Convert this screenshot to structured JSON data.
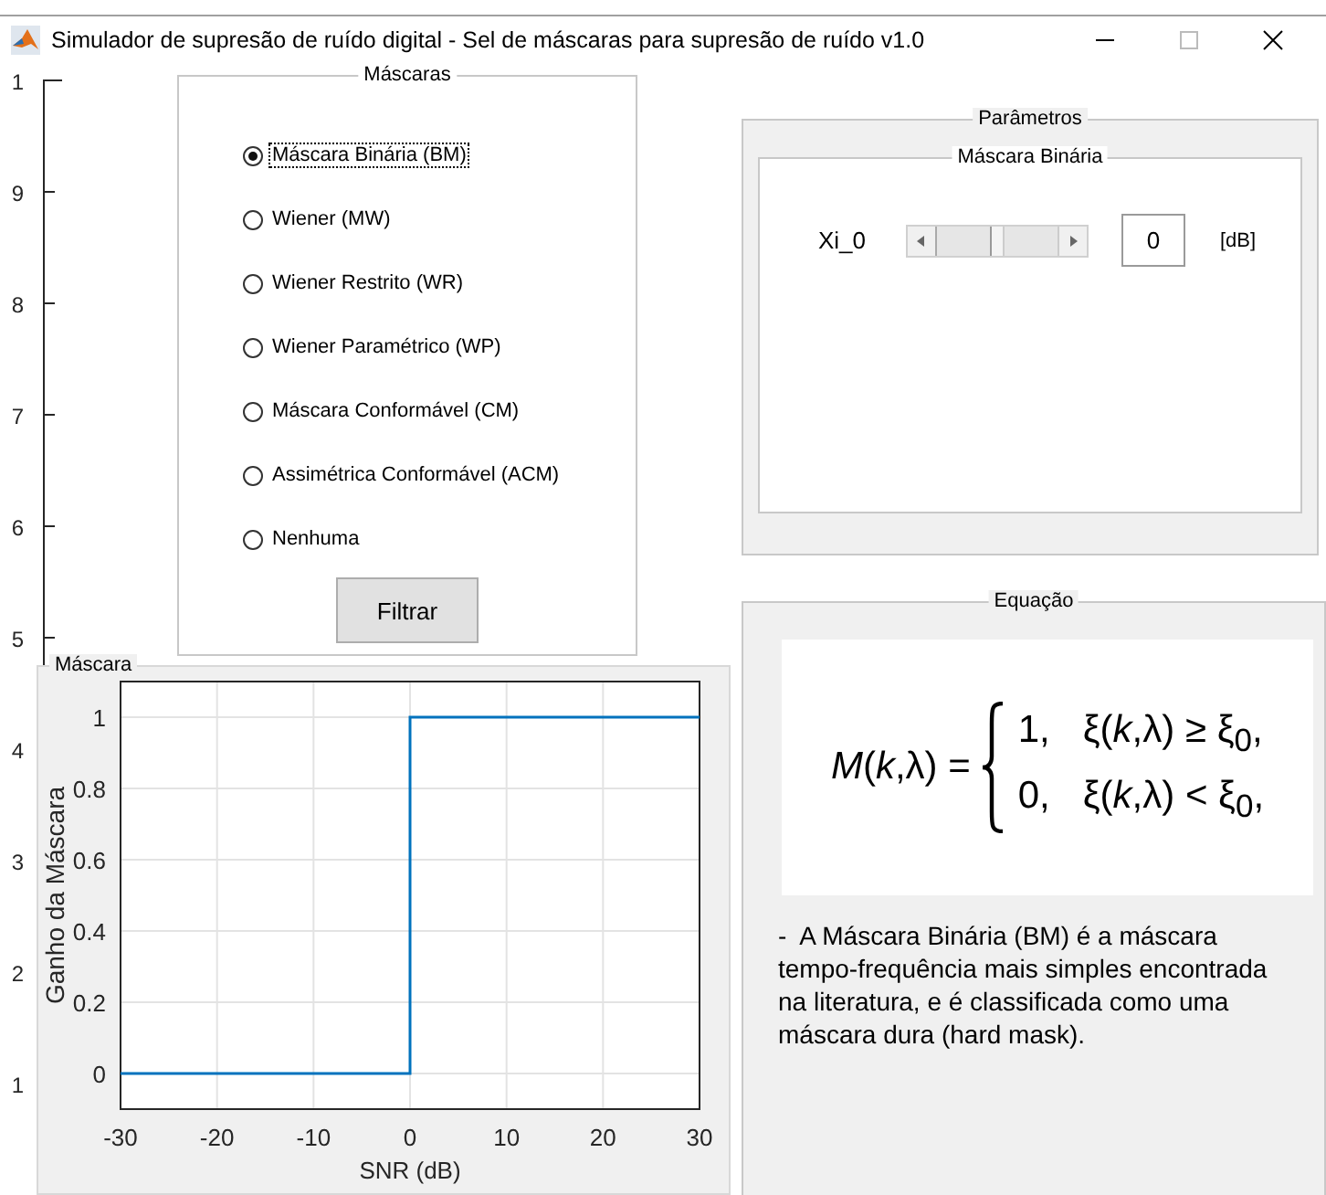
{
  "window": {
    "title": "Simulador de supresão de ruído digital - Sel de máscaras para supresão de ruído v1.0"
  },
  "background_axis": {
    "tick_labels": [
      "1",
      "9",
      "8",
      "7",
      "6",
      "5",
      "4",
      "3",
      "2",
      "1"
    ]
  },
  "masks_panel": {
    "title": "Máscaras",
    "options": [
      {
        "label": "Máscara Binária (BM)",
        "selected": true
      },
      {
        "label": "Wiener (MW)",
        "selected": false
      },
      {
        "label": "Wiener Restrito (WR)",
        "selected": false
      },
      {
        "label": "Wiener Paramétrico (WP)",
        "selected": false
      },
      {
        "label": "Máscara Conformável (CM)",
        "selected": false
      },
      {
        "label": "Assimétrica Conformável (ACM)",
        "selected": false
      },
      {
        "label": "Nenhuma",
        "selected": false
      }
    ],
    "button": "Filtrar"
  },
  "parameters_panel": {
    "title": "Parâmetros",
    "subpanel": {
      "title": "Máscara Binária",
      "slider": {
        "label": "Xi_0",
        "level": 0.5,
        "value": "0",
        "unit": "[dB]"
      }
    }
  },
  "plot_panel": {
    "title": "Máscara",
    "chart_data": {
      "type": "line",
      "xlabel": "SNR (dB)",
      "ylabel": "Ganho da Máscara",
      "x": [
        -30,
        0,
        0,
        30
      ],
      "series": [
        {
          "color": "#0072bd",
          "values": [
            0,
            0,
            1,
            1
          ]
        }
      ],
      "grid": true,
      "xlim": [
        -30,
        30
      ],
      "ylim": [
        -0.1,
        1.1
      ],
      "xticks": [
        -30,
        -20,
        -10,
        0,
        10,
        20,
        30
      ],
      "yticks": [
        0,
        0.2,
        0.4,
        0.6,
        0.8,
        1
      ]
    }
  },
  "equation_panel": {
    "title": "Equação",
    "equation": {
      "lhs": "*M*(*k*,λ) =",
      "cases": [
        {
          "value": "1,",
          "condition": "ξ(*k*,λ) ≥ ξ$_{0}$,"
        },
        {
          "value": "0,",
          "condition": "ξ(*k*,λ) < ξ$_{0}$,"
        }
      ]
    },
    "description": "-  A Máscara Binária (BM) é a máscara tempo-frequência mais simples encontrada na literatura, e é classificada como uma máscara dura (hard mask)."
  }
}
